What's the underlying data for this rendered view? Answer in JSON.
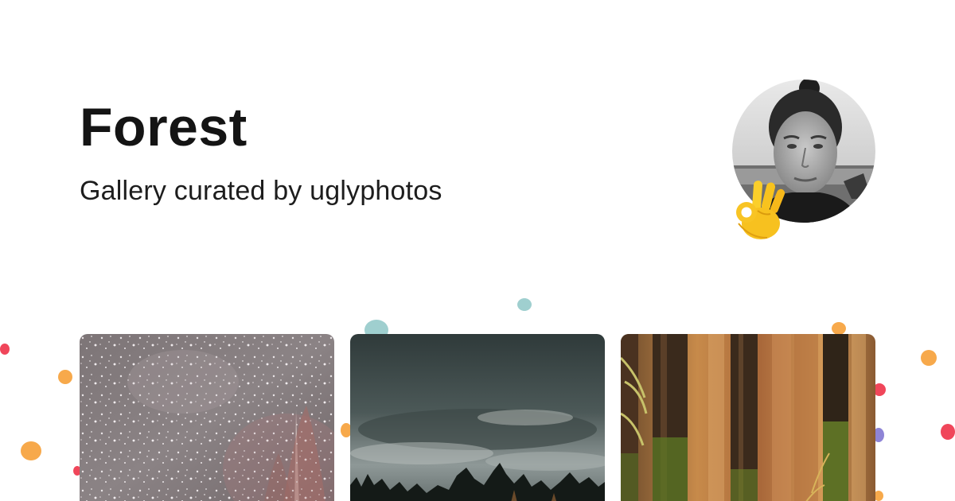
{
  "page": {
    "title": "Forest",
    "subtitle": "Gallery curated by uglyphotos"
  },
  "avatar": {
    "alt": "curator avatar",
    "badge_icon": "ok-hand-icon"
  },
  "gallery": {
    "photos": [
      {
        "name": "snowy-forest-photo",
        "icon": "image-icon"
      },
      {
        "name": "stormy-sky-forest-photo",
        "icon": "image-icon"
      },
      {
        "name": "autumn-tree-trunks-photo",
        "icon": "image-icon"
      }
    ]
  },
  "colors": {
    "title": "#141414",
    "subtitle": "#1d1d1d",
    "background": "#ffffff",
    "dot_red": "#f0465a",
    "dot_orange": "#f7a94b",
    "dot_teal": "#9fcfcf",
    "dot_purple": "#8e84d6"
  }
}
